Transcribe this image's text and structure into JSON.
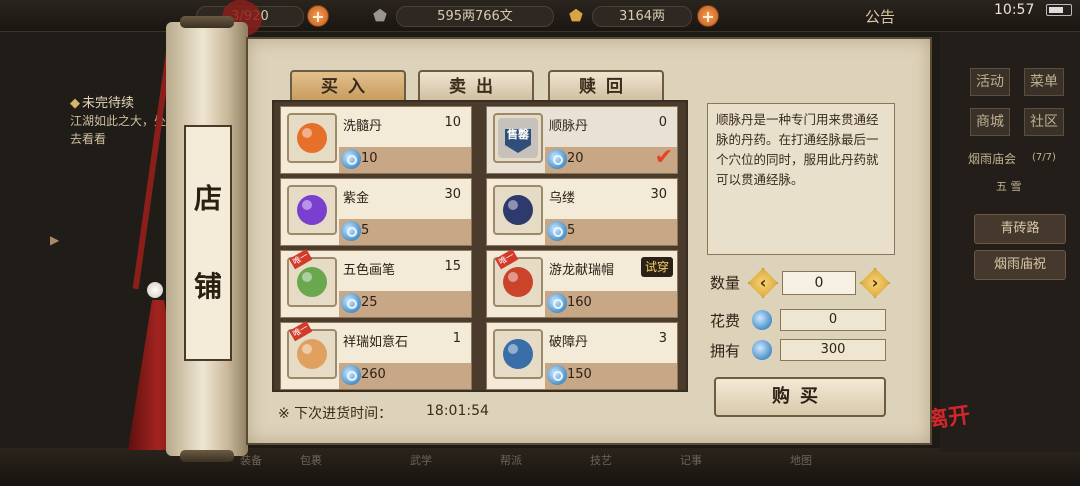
{
  "topbar": {
    "bag_count": "3/920",
    "silver": "595两766文",
    "gold": "3164两",
    "notice": "公告",
    "clock": "10:57"
  },
  "quest": {
    "title": "未完待续",
    "desc": "江湖如此之大，处去看看"
  },
  "bottom_buttons": [
    "装备",
    "包裹",
    "武学",
    "帮派",
    "技艺",
    "记事",
    "地图"
  ],
  "right_panel": {
    "buttons": [
      "活动",
      "菜单",
      "商城",
      "社区"
    ],
    "event": "烟雨庙会",
    "event_count": "(7/7)",
    "sub": "五 雪",
    "road": "青砖路",
    "temple": "烟雨庙祝"
  },
  "leave_label": "离开",
  "shop_sign": [
    "店",
    "铺"
  ],
  "tabs": [
    "买入",
    "卖出",
    "赎回"
  ],
  "items": [
    {
      "name": "洗髓丹",
      "stock": "10",
      "price": "10",
      "icon": "pill-bowl-icon",
      "color": "#e6702a"
    },
    {
      "name": "顺脉丹",
      "stock": "0",
      "price": "20",
      "icon": "sold-out-icon",
      "color": "#2f4e7a",
      "sold_out": "售罄",
      "selected": true
    },
    {
      "name": "紫金",
      "stock": "30",
      "price": "5",
      "icon": "purple-gem-icon",
      "color": "#7b3fd0"
    },
    {
      "name": "乌缕",
      "stock": "30",
      "price": "5",
      "icon": "thread-spool-icon",
      "color": "#2e3a6e"
    },
    {
      "name": "五色画笔",
      "stock": "15",
      "price": "25",
      "icon": "brush-icon",
      "color": "#6aa84f",
      "tag": "唯一"
    },
    {
      "name": "游龙献瑞帽",
      "stock": "",
      "price": "160",
      "icon": "dragon-hat-icon",
      "color": "#c9442a",
      "tag": "唯一",
      "badge": "试穿"
    },
    {
      "name": "祥瑞如意石",
      "stock": "1",
      "price": "260",
      "icon": "lucky-stone-icon",
      "color": "#e0a060",
      "tag": "唯一"
    },
    {
      "name": "破障丹",
      "stock": "3",
      "price": "150",
      "icon": "blue-orb-icon",
      "color": "#3a6ea8"
    }
  ],
  "restock": {
    "label": "※ 下次进货时间：",
    "time": "18:01:54"
  },
  "description": "顺脉丹是一种专门用来贯通经脉的丹药。在打通经脉最后一个穴位的同时，服用此丹药就可以贯通经脉。",
  "purchase": {
    "qty_label": "数量",
    "qty_value": "0",
    "cost_label": "花费",
    "cost_value": "0",
    "own_label": "拥有",
    "own_value": "300",
    "buy_label": "购买"
  }
}
